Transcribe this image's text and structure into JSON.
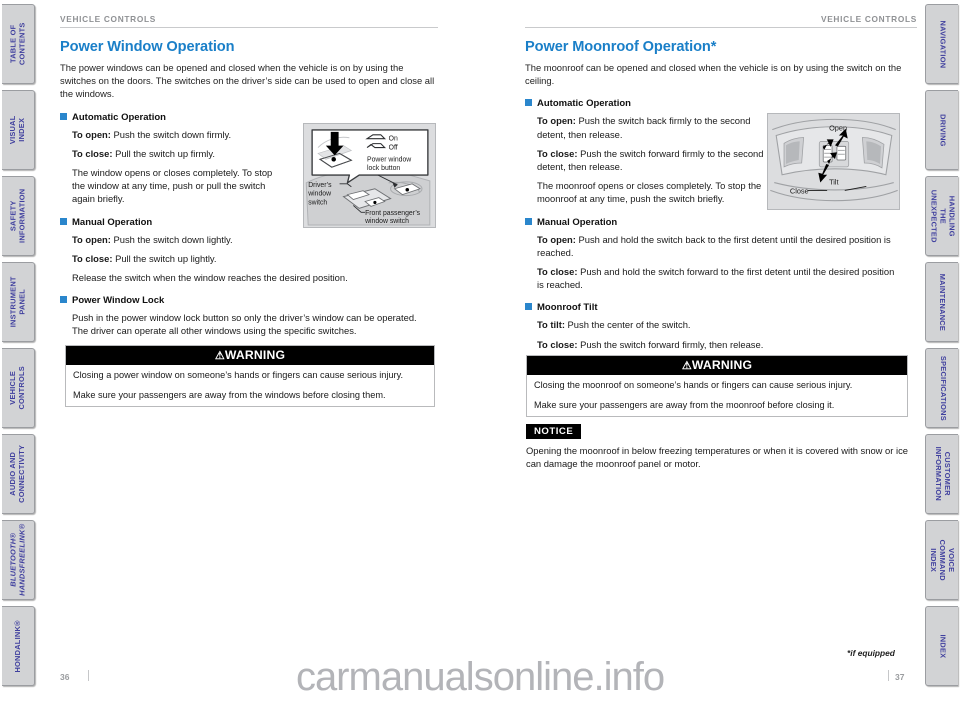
{
  "document": {
    "running_header": "VEHICLE CONTROLS",
    "page_left": "36",
    "page_right": "37",
    "footnote": "*if equipped",
    "watermark": "carmanualsonline.info",
    "accent_color": "#1a7fc8",
    "bullet_color": "#2a86cc",
    "tab_text_color": "#3f3f9e",
    "tab_bg_color": "#d2d3d5"
  },
  "sidebar_left": {
    "items": [
      {
        "label": "TABLE OF CONTENTS",
        "italic": false
      },
      {
        "label": "VISUAL INDEX",
        "italic": false
      },
      {
        "label": "SAFETY\nINFORMATION",
        "italic": false
      },
      {
        "label": "INSTRUMENT PANEL",
        "italic": false
      },
      {
        "label": "VEHICLE\nCONTROLS",
        "italic": false
      },
      {
        "label": "AUDIO AND\nCONNECTIVITY",
        "italic": false
      },
      {
        "label": "BLUETOOTH®\nHANDSFREELINK®",
        "italic": true
      },
      {
        "label": "HONDALINK®",
        "italic": false
      }
    ]
  },
  "sidebar_right": {
    "items": [
      {
        "label": "NAVIGATION"
      },
      {
        "label": "DRIVING"
      },
      {
        "label": "HANDLING THE\nUNEXPECTED"
      },
      {
        "label": "MAINTENANCE"
      },
      {
        "label": "SPECIFICATIONS"
      },
      {
        "label": "CUSTOMER\nINFORMATION"
      },
      {
        "label": "VOICE COMMAND\nINDEX"
      },
      {
        "label": "INDEX"
      }
    ]
  },
  "left_column": {
    "header": "VEHICLE CONTROLS",
    "title": "Power Window Operation",
    "intro": "The power windows can be opened and closed when the vehicle is on by using the switches on the doors. The switches on the driver’s side can be used to open and close all the windows.",
    "sections": [
      {
        "heading": "Automatic Operation",
        "items": [
          {
            "lead": "To open:",
            "text": " Push the switch down firmly."
          },
          {
            "lead": "To close:",
            "text": " Pull the switch up firmly."
          },
          {
            "lead": "",
            "text": "The window opens or closes completely. To stop the window at any time, push or pull the switch again briefly."
          }
        ]
      },
      {
        "heading": "Manual Operation",
        "items": [
          {
            "lead": "To open:",
            "text": " Push the switch down lightly."
          },
          {
            "lead": "To close:",
            "text": " Pull the switch up lightly."
          },
          {
            "lead": "",
            "text": "Release the switch when the window reaches the desired position."
          }
        ]
      },
      {
        "heading": "Power Window Lock",
        "items": [
          {
            "lead": "",
            "text": "Push in the power window lock button so only the driver’s window can be operated. The driver can operate all other windows using the specific switches."
          }
        ]
      }
    ],
    "figure": {
      "name": "power-window-switch-diagram",
      "labels": {
        "on": "On",
        "off": "Off",
        "lock_button": "Power window\nlock button",
        "drivers_switch": "Driver’s\nwindow\nswitch",
        "passenger_switch": "Front passenger’s\nwindow switch"
      }
    },
    "warning": {
      "title": "WARNING",
      "lines": [
        "Closing a power window on someone’s hands or fingers can cause serious injury.",
        "Make sure your passengers are away from the windows before closing them."
      ]
    }
  },
  "right_column": {
    "header": "VEHICLE CONTROLS",
    "title": "Power Moonroof Operation*",
    "intro": "The moonroof can be opened and closed when the vehicle is on by using the switch on the ceiling.",
    "sections": [
      {
        "heading": "Automatic Operation",
        "items": [
          {
            "lead": "To open:",
            "text": " Push the switch back firmly to the second detent, then release."
          },
          {
            "lead": "To close:",
            "text": " Push the switch forward firmly to the second detent, then release."
          },
          {
            "lead": "",
            "text": "The moonroof opens or closes completely. To stop the moonroof at any time, push the switch briefly."
          }
        ]
      },
      {
        "heading": "Manual Operation",
        "items": [
          {
            "lead": "To open:",
            "text": " Push and hold the switch back to the first detent until the desired position is reached."
          },
          {
            "lead": "To close:",
            "text": " Push and hold the switch forward to the first detent until the desired position is reached."
          }
        ]
      },
      {
        "heading": "Moonroof Tilt",
        "items": [
          {
            "lead": "To tilt:",
            "text": " Push the center of the switch."
          },
          {
            "lead": "To close:",
            "text": " Push the switch forward firmly, then release."
          }
        ]
      }
    ],
    "figure": {
      "name": "moonroof-switch-diagram",
      "labels": {
        "open": "Open",
        "tilt": "Tilt",
        "close": "Close"
      }
    },
    "warning": {
      "title": "WARNING",
      "lines": [
        "Closing the moonroof on someone’s hands or fingers can cause serious injury.",
        "Make sure your passengers are away from the moonroof before closing it."
      ]
    },
    "notice": {
      "tag": "NOTICE",
      "text": "Opening the moonroof in below freezing temperatures or when it is covered with snow or ice can damage the moonroof panel or motor."
    }
  }
}
